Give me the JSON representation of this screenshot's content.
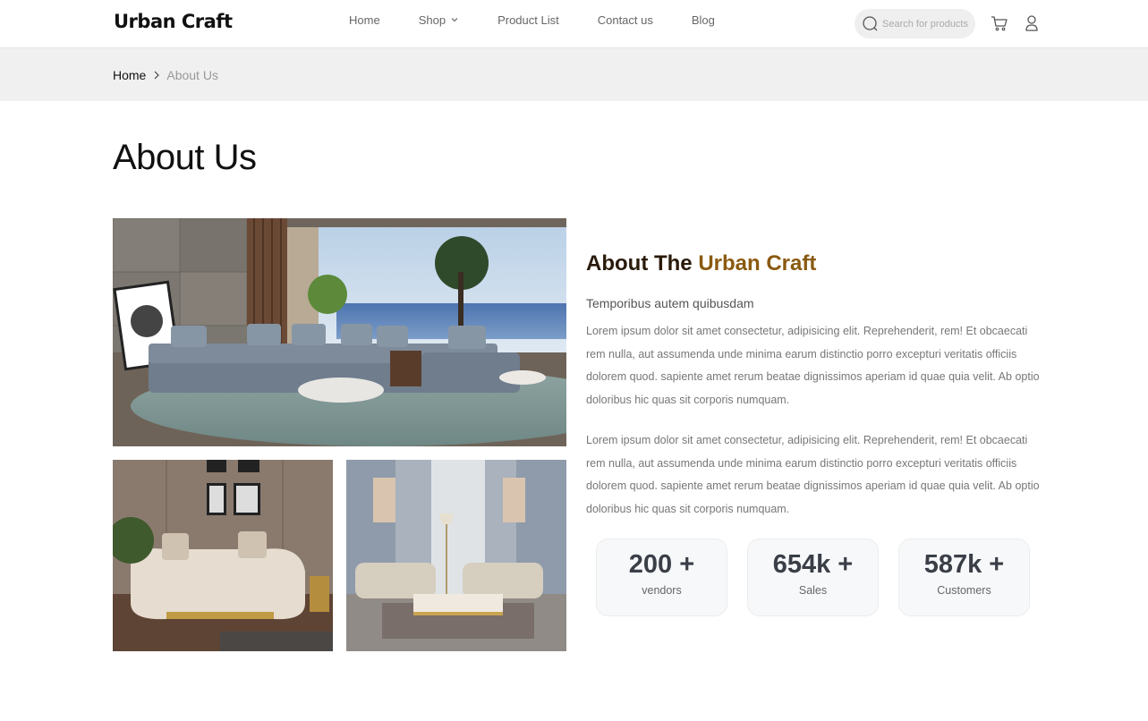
{
  "header": {
    "logo": "Urban Craft",
    "nav": [
      "Home",
      "Shop",
      "Product List",
      "Contact us",
      "Blog"
    ],
    "search_placeholder": "Search for products"
  },
  "breadcrumb": {
    "home": "Home",
    "current": "About Us"
  },
  "page_title": "About Us",
  "about": {
    "heading_prefix": "About The",
    "heading_brand": "Urban Craft",
    "subheading": "Temporibus autem quibusdam",
    "paragraph_1": "Lorem ipsum dolor sit amet consectetur, adipisicing elit. Reprehenderit, rem! Et obcaecati rem nulla, aut assumenda unde minima earum distinctio porro excepturi veritatis officiis dolorem quod. sapiente amet rerum beatae dignissimos aperiam id quae quia velit. Ab optio doloribus hic quas sit corporis numquam.",
    "paragraph_2": "Lorem ipsum dolor sit amet consectetur, adipisicing elit. Reprehenderit, rem! Et obcaecati rem nulla, aut assumenda unde minima earum distinctio porro excepturi veritatis officiis dolorem quod. sapiente amet rerum beatae dignissimos aperiam id quae quia velit. Ab optio doloribus hic quas sit corporis numquam."
  },
  "stats": [
    {
      "value": "200 +",
      "label": "vendors"
    },
    {
      "value": "654k +",
      "label": "Sales"
    },
    {
      "value": "587k +",
      "label": "Customers"
    }
  ],
  "colors": {
    "brand": "#8a5a10",
    "heading": "#2a1a0a",
    "breadcrumb_bg": "#f0f0f0",
    "stat_bg": "#f7f8fa"
  },
  "icons": [
    "search-icon",
    "cart-icon",
    "user-icon",
    "chevron-down-icon",
    "chevron-right-icon"
  ]
}
